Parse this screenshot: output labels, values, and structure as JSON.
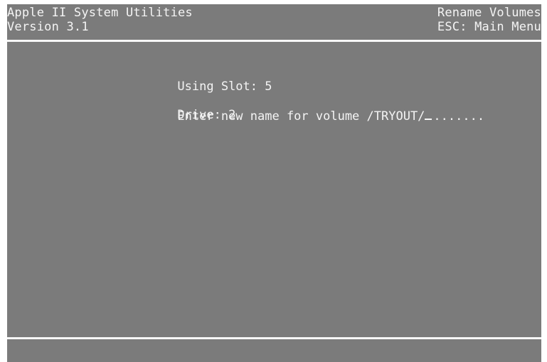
{
  "header": {
    "app_title": "Apple II System Utilities",
    "version": "Version 3.1",
    "screen_title": "Rename Volumes",
    "escape_hint": "ESC: Main Menu"
  },
  "status": {
    "slot_label": "Using Slot: 5",
    "drive_label": "Drive: 2"
  },
  "prompt": {
    "text": "Enter new name for volume /TRYOUT/",
    "input_value": "",
    "input_placeholder": "......."
  },
  "colors": {
    "background": "#7b7b7b",
    "text": "#f4f4f4"
  }
}
